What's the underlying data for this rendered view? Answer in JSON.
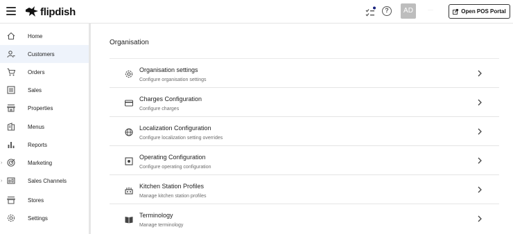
{
  "header": {
    "brand": "flipdish",
    "avatar_initials": "AD",
    "language": "····",
    "open_pos_label": "Open POS Portal"
  },
  "sidebar": {
    "items": [
      {
        "label": "Home",
        "icon": "home-icon"
      },
      {
        "label": "Customers",
        "icon": "customers-icon",
        "active": true
      },
      {
        "label": "Orders",
        "icon": "cart-icon"
      },
      {
        "label": "Sales",
        "icon": "sales-icon"
      },
      {
        "label": "Properties",
        "icon": "storefront-icon"
      },
      {
        "label": "Menus",
        "icon": "menu-book-icon"
      },
      {
        "label": "Reports",
        "icon": "bar-chart-icon"
      },
      {
        "label": "Marketing",
        "icon": "target-icon",
        "expandable": true
      },
      {
        "label": "Sales Channels",
        "icon": "channels-icon",
        "expandable": true
      },
      {
        "label": "Stores",
        "icon": "store-icon"
      },
      {
        "label": "Settings",
        "icon": "gear-icon"
      }
    ]
  },
  "main": {
    "section_title": "Organisation",
    "rows": [
      {
        "title": "Organisation settings",
        "subtitle": "Configure organisation settings",
        "icon": "gear-icon"
      },
      {
        "title": "Charges Configuration",
        "subtitle": "Configure charges",
        "icon": "credit-card-icon"
      },
      {
        "title": "Localization Configuration",
        "subtitle": "Configure localization setting overrides",
        "icon": "globe-icon"
      },
      {
        "title": "Operating Configuration",
        "subtitle": "Configure operating configuration",
        "icon": "settings-box-icon"
      },
      {
        "title": "Kitchen Station Profiles",
        "subtitle": "Manage kitchen station profiles",
        "icon": "kitchen-icon"
      },
      {
        "title": "Terminology",
        "subtitle": "Manage terminology",
        "icon": "book-icon"
      }
    ]
  },
  "colors": {
    "active_bg": "#eef3fb",
    "notification_dot": "#1a237e",
    "avatar_bg": "#bdbdbd"
  }
}
